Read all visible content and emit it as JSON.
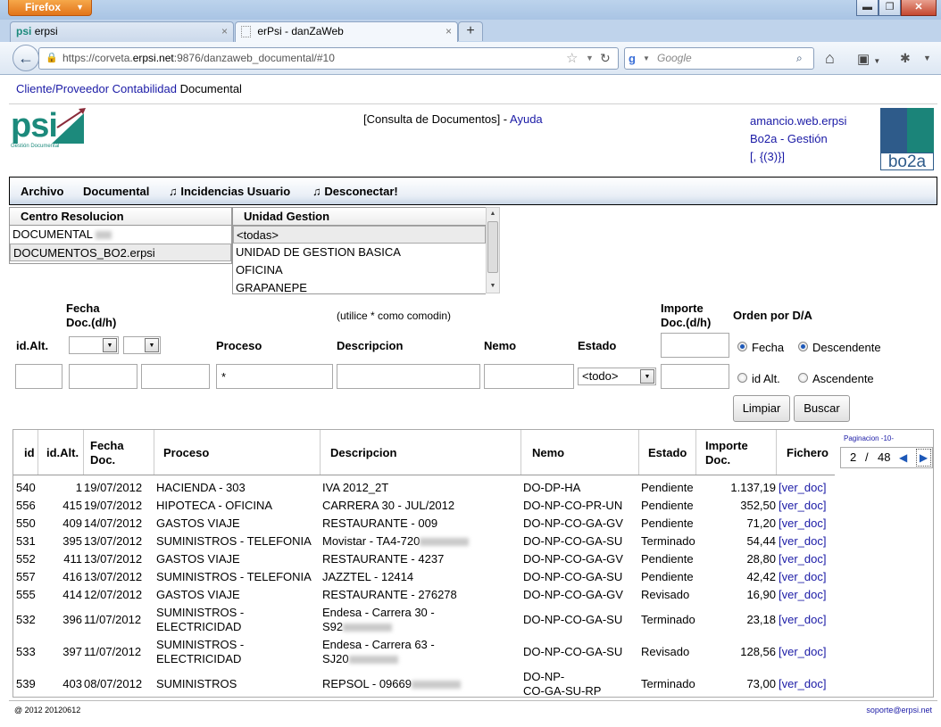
{
  "browser": {
    "app_button": "Firefox",
    "tabs": [
      {
        "icon": "psi",
        "label": "erpsi",
        "close": "×"
      },
      {
        "label": "erPsi - danZaWeb",
        "close": "×"
      }
    ],
    "new_tab": "+",
    "url_prefix": "https://corveta.",
    "url_domain": "erpsi.net",
    "url_suffix": ":9876/danzaweb_documental/#10",
    "search_placeholder": "Google"
  },
  "page": {
    "top_links": {
      "link": "Cliente/Proveedor Contabilidad",
      "text": "Documental"
    },
    "logo": {
      "text": "psi",
      "sub": "Gestión Documental"
    },
    "header_center": {
      "prefix": "[Consulta de Documentos] - ",
      "link": "Ayuda"
    },
    "header_right": [
      "amancio.web.erpsi",
      "Bo2a - Gestión",
      "[, {(3)}]"
    ],
    "brand_logo": "bo2a",
    "menu": [
      "Archivo",
      "Documental",
      "♫ Incidencias Usuario",
      "♫ Desconectar!"
    ],
    "centro": {
      "header": "Centro Resolucion",
      "items": [
        "DOCUMENTAL",
        "DOCUMENTOS_BO2.erpsi"
      ]
    },
    "unidad": {
      "header": "Unidad Gestion",
      "items": [
        "<todas>",
        "UNIDAD DE GESTION BASICA",
        "OFICINA",
        "GRAPANEPE"
      ]
    },
    "filters": {
      "fecha_label_1": "Fecha",
      "fecha_label_2": "Doc.(d/h)",
      "hint": "(utilice * como comodin)",
      "importe_label_1": "Importe",
      "importe_label_2": "Doc.(d/h)",
      "orden_label": "Orden por D/A",
      "id_alt": "id.Alt.",
      "proceso": "Proceso",
      "descripcion": "Descripcion",
      "nemo": "Nemo",
      "estado": "Estado",
      "proceso_value": "*",
      "estado_value": "<todo>",
      "radio_fecha": "Fecha",
      "radio_descendente": "Descendente",
      "radio_id_alt": "id Alt.",
      "radio_ascendente": "Ascendente",
      "btn_limpiar": "Limpiar",
      "btn_buscar": "Buscar"
    },
    "table": {
      "headers": {
        "id": "id",
        "id_alt": "id.Alt.",
        "fecha": [
          "Fecha",
          "Doc."
        ],
        "proceso": "Proceso",
        "descripcion": "Descripcion",
        "nemo": "Nemo",
        "estado": "Estado",
        "importe": [
          "Importe",
          "Doc."
        ],
        "fichero": "Fichero"
      },
      "rows": [
        {
          "id": "540",
          "alt": "1",
          "fecha": "19/07/2012",
          "proceso": [
            "HACIENDA - 303"
          ],
          "desc": [
            "IVA 2012_2T"
          ],
          "nemo": [
            "DO-DP-HA"
          ],
          "estado": "Pendiente",
          "importe": "1.137,19",
          "fichero": "[ver_doc]"
        },
        {
          "id": "556",
          "alt": "415",
          "fecha": "19/07/2012",
          "proceso": [
            "HIPOTECA - OFICINA"
          ],
          "desc": [
            "CARRERA 30 - JUL/2012"
          ],
          "nemo": [
            "DO-NP-CO-PR-UN"
          ],
          "estado": "Pendiente",
          "importe": "352,50",
          "fichero": "[ver_doc]"
        },
        {
          "id": "550",
          "alt": "409",
          "fecha": "14/07/2012",
          "proceso": [
            "GASTOS VIAJE"
          ],
          "desc": [
            "RESTAURANTE - 009"
          ],
          "nemo": [
            "DO-NP-CO-GA-GV"
          ],
          "estado": "Pendiente",
          "importe": "71,20",
          "fichero": "[ver_doc]"
        },
        {
          "id": "531",
          "alt": "395",
          "fecha": "13/07/2012",
          "proceso": [
            "SUMINISTROS - TELEFONIA"
          ],
          "desc": [
            "Movistar - TA4-720"
          ],
          "nemo": [
            "DO-NP-CO-GA-SU"
          ],
          "estado": "Terminado",
          "importe": "54,44",
          "fichero": "[ver_doc]"
        },
        {
          "id": "552",
          "alt": "411",
          "fecha": "13/07/2012",
          "proceso": [
            "GASTOS VIAJE"
          ],
          "desc": [
            "RESTAURANTE - 4237"
          ],
          "nemo": [
            "DO-NP-CO-GA-GV"
          ],
          "estado": "Pendiente",
          "importe": "28,80",
          "fichero": "[ver_doc]"
        },
        {
          "id": "557",
          "alt": "416",
          "fecha": "13/07/2012",
          "proceso": [
            "SUMINISTROS - TELEFONIA"
          ],
          "desc": [
            "JAZZTEL - 12414"
          ],
          "nemo": [
            "DO-NP-CO-GA-SU"
          ],
          "estado": "Pendiente",
          "importe": "42,42",
          "fichero": "[ver_doc]"
        },
        {
          "id": "555",
          "alt": "414",
          "fecha": "12/07/2012",
          "proceso": [
            "GASTOS VIAJE"
          ],
          "desc": [
            "RESTAURANTE - 276278"
          ],
          "nemo": [
            "DO-NP-CO-GA-GV"
          ],
          "estado": "Revisado",
          "importe": "16,90",
          "fichero": "[ver_doc]"
        },
        {
          "id": "532",
          "alt": "396",
          "fecha": "11/07/2012",
          "proceso": [
            "SUMINISTROS -",
            "ELECTRICIDAD"
          ],
          "desc": [
            "Endesa - Carrera 30 -",
            "S92"
          ],
          "nemo": [
            "DO-NP-CO-GA-SU"
          ],
          "estado": "Terminado",
          "importe": "23,18",
          "fichero": "[ver_doc]"
        },
        {
          "id": "533",
          "alt": "397",
          "fecha": "11/07/2012",
          "proceso": [
            "SUMINISTROS -",
            "ELECTRICIDAD"
          ],
          "desc": [
            "Endesa - Carrera 63 -",
            "SJ20"
          ],
          "nemo": [
            "DO-NP-CO-GA-SU"
          ],
          "estado": "Revisado",
          "importe": "128,56",
          "fichero": "[ver_doc]"
        },
        {
          "id": "539",
          "alt": "403",
          "fecha": "08/07/2012",
          "proceso": [
            "SUMINISTROS"
          ],
          "desc": [
            "REPSOL - 09669"
          ],
          "nemo": [
            "DO-NP-",
            "CO-GA-SU-RP"
          ],
          "estado": "Terminado",
          "importe": "73,00",
          "fichero": "[ver_doc]"
        }
      ]
    },
    "pager": {
      "label": "Paginacion -10-",
      "current": "2",
      "sep": "/",
      "total": "48",
      "prev": "◀",
      "next": "▶"
    },
    "footer": {
      "left": "@ 2012 20120612",
      "right": "soporte@erpsi.net"
    }
  }
}
